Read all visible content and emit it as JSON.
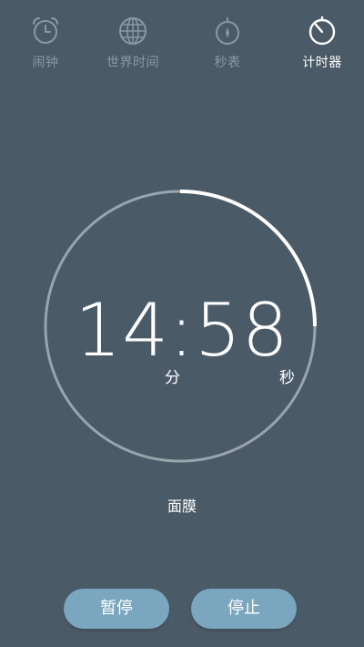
{
  "tabs": [
    {
      "label": "闹钟",
      "icon": "alarm-clock-icon",
      "active": false
    },
    {
      "label": "世界时间",
      "icon": "globe-icon",
      "active": false
    },
    {
      "label": "秒表",
      "icon": "stopwatch-icon",
      "active": false
    },
    {
      "label": "计时器",
      "icon": "timer-icon",
      "active": true
    }
  ],
  "timer": {
    "minutes": "14",
    "seconds": "58",
    "separator": ":",
    "display": "14:58",
    "minute_unit": "分",
    "second_unit": "秒",
    "name": "面膜",
    "remaining_fraction": 0.25
  },
  "buttons": {
    "pause_label": "暂停",
    "stop_label": "停止"
  },
  "colors": {
    "background": "#4a5a67",
    "ring_track": "#9aa4ab",
    "ring_active": "#ffffff",
    "button": "#7ba6bf",
    "tab_inactive": "#8a99a4",
    "tab_active": "#ffffff"
  }
}
